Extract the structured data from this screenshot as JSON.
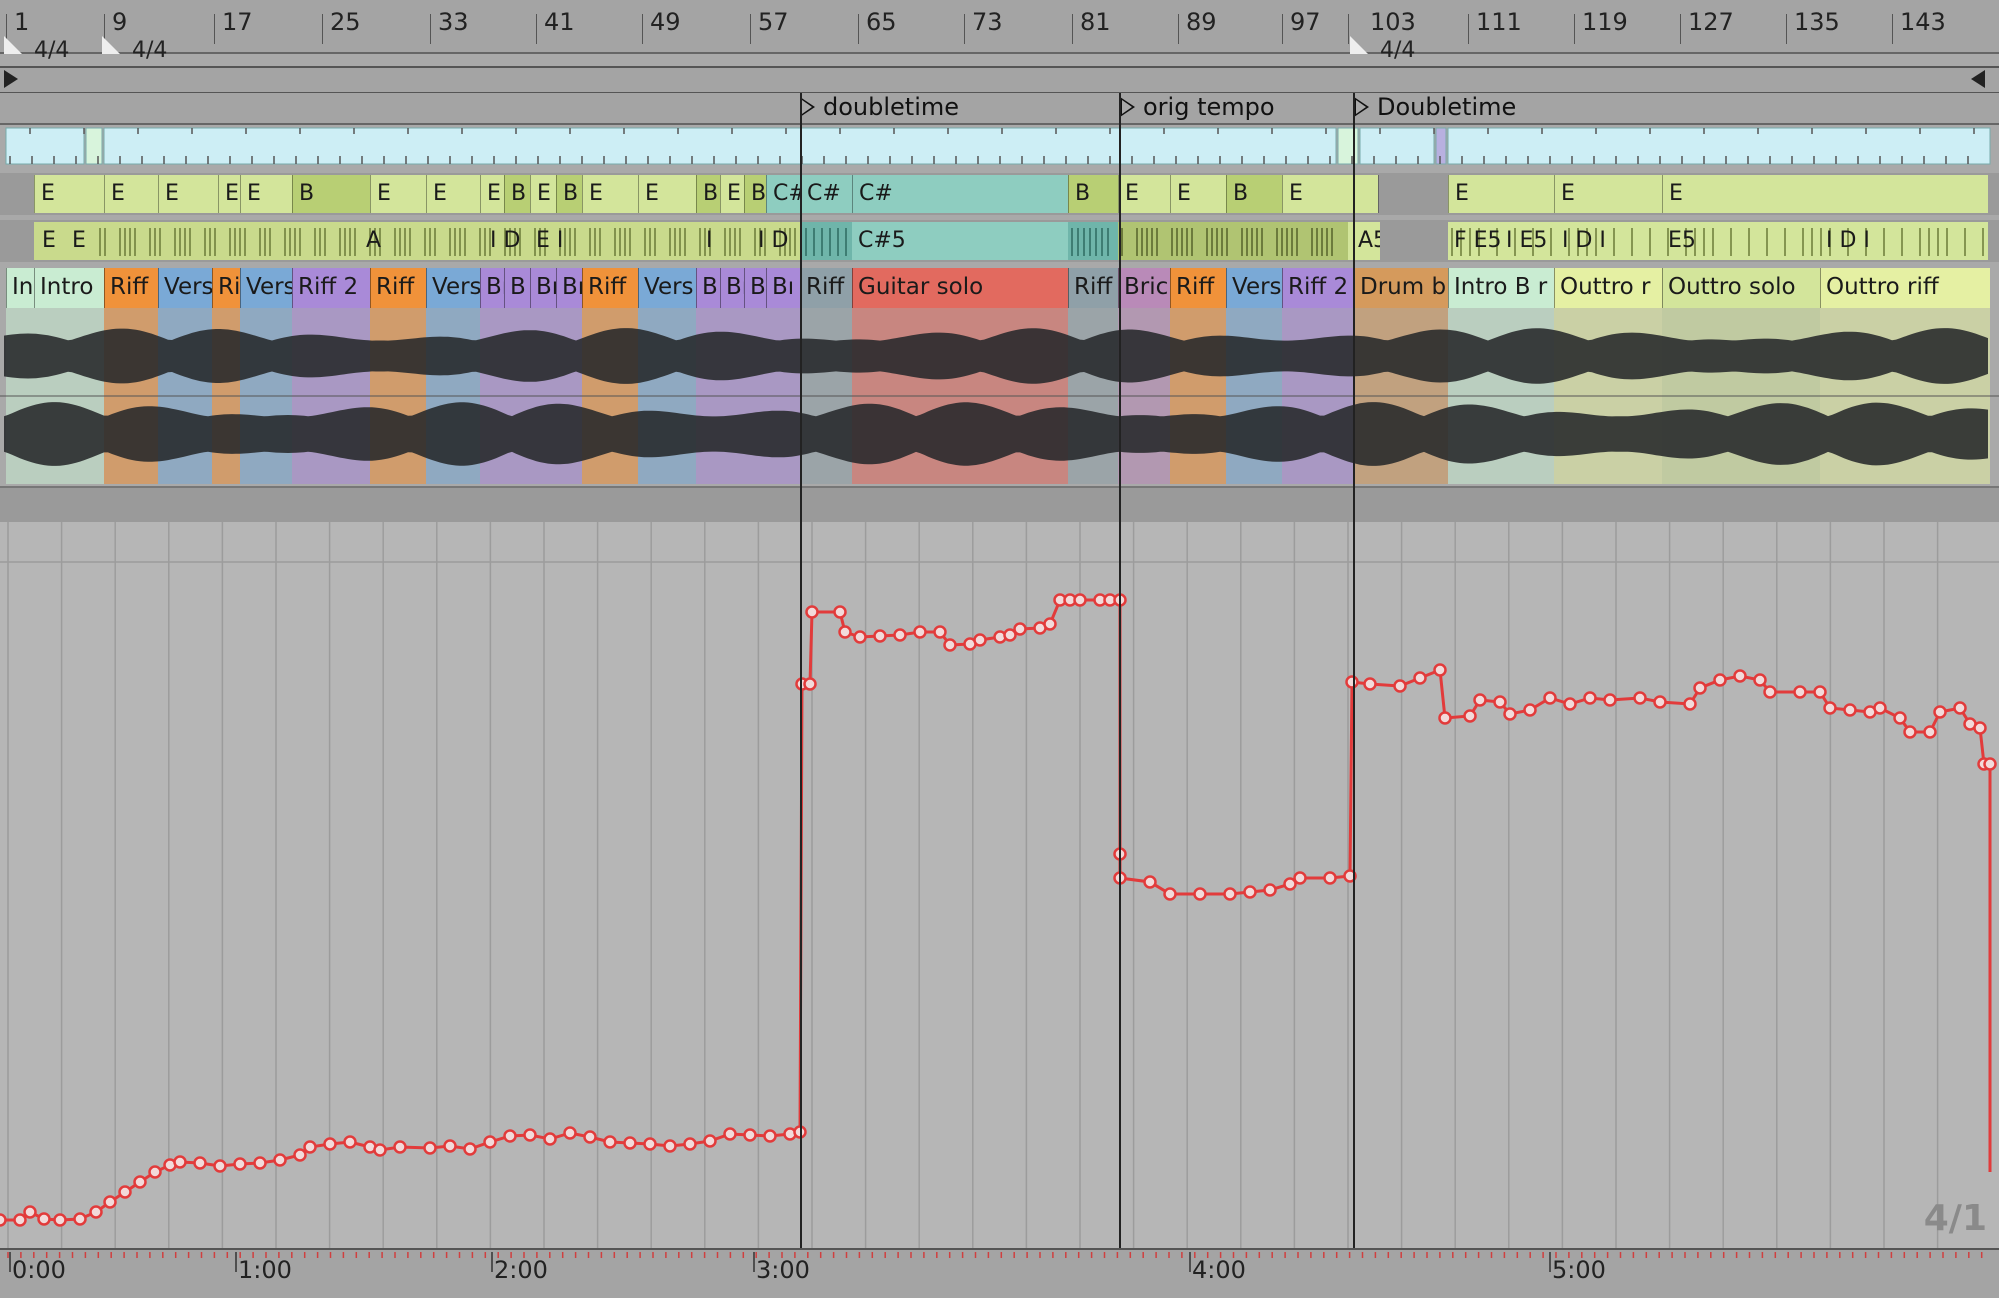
{
  "ruler": {
    "bar_numbers": [
      "1",
      "9",
      "17",
      "25",
      "33",
      "41",
      "49",
      "57",
      "65",
      "73",
      "81",
      "89",
      "97",
      "103",
      "111",
      "119",
      "127",
      "135",
      "143"
    ],
    "time_signatures": [
      "4/4",
      "4/4",
      "4/4"
    ]
  },
  "locators": [
    "doubletime",
    "orig tempo",
    "Doubletime"
  ],
  "chord_track": {
    "labels": [
      "E",
      "E",
      "E",
      "E",
      "E",
      "B",
      "E",
      "E",
      "E",
      "B",
      "E",
      "B",
      "E",
      "E",
      "B",
      "E",
      "B",
      "C#",
      "C#",
      "C#",
      "B",
      "E",
      "E",
      "B",
      "E",
      "E",
      "E",
      "E"
    ]
  },
  "note_track": {
    "labels": [
      "E",
      "E",
      "A",
      "I D",
      "E I",
      "I",
      "I D",
      "C#5",
      "A5",
      "F E5",
      "I E5",
      "I D I",
      "E5",
      "I D I"
    ]
  },
  "section_track": {
    "labels": [
      "In",
      "Intro",
      "Riff",
      "Vers",
      "Ri",
      "Vers",
      "Riff 2",
      "Riff",
      "Vers",
      "Bı",
      "B",
      "Bı",
      "Bı",
      "Riff",
      "Vers",
      "B",
      "Bı",
      "Bı",
      "Bı",
      "Riff",
      "Guitar solo",
      "Riff",
      "Bric",
      "Riff",
      "Vers",
      "Riff 2",
      "Drum b",
      "Intro B r",
      "Outtro r",
      "Outtro solo",
      "Outtro riff"
    ]
  },
  "automation": {
    "color": "#e23b3b",
    "description_visible": ""
  },
  "time_ruler": {
    "labels": [
      "0:00",
      "1:00",
      "2:00",
      "3:00",
      "4:00",
      "5:00"
    ]
  },
  "zoom_label": "4/1",
  "colors": {
    "background": "#a9a9a9",
    "automation_line": "#e23b3b",
    "light_blue_track": "#cdeef5",
    "chord_green": "#d3e59b",
    "chord_teal": "#8ecdc0",
    "guitar_solo": "#e26a5f",
    "riff_orange": "#f0923a",
    "verse_blue": "#7aa9d6",
    "intro_green": "#c9ecd2",
    "bridge_purple": "#a98ad8",
    "drum_tan": "#d59a5c",
    "outro_yellow": "#e5f0a3"
  }
}
